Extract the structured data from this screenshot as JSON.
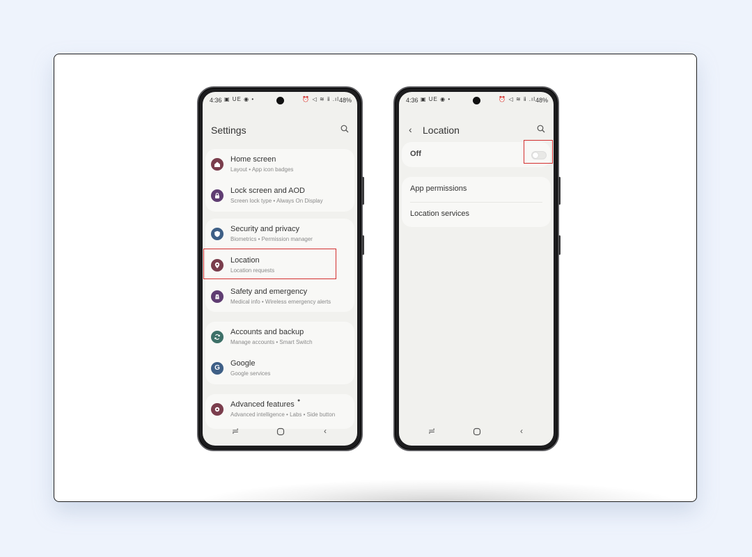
{
  "status_bar": {
    "time": "4:36",
    "left_icons": "▣ UE ◉ •",
    "right_icons": "⏰ ◁ ≋ ⅱ .ıl",
    "battery": "48%"
  },
  "left_phone": {
    "title": "Settings",
    "items": [
      {
        "label": "Home screen",
        "sub": "Layout • App icon badges",
        "icon": "home-icon",
        "color": "#7a3d4c"
      },
      {
        "label": "Lock screen and AOD",
        "sub": "Screen lock type • Always On Display",
        "icon": "lock-icon",
        "color": "#5f3d72"
      },
      {
        "label": "Security and privacy",
        "sub": "Biometrics • Permission manager",
        "icon": "shield-icon",
        "color": "#3e5f86"
      },
      {
        "label": "Location",
        "sub": "Location requests",
        "icon": "location-pin-icon",
        "color": "#7a3d4c"
      },
      {
        "label": "Safety and emergency",
        "sub": "Medical info • Wireless emergency alerts",
        "icon": "emergency-icon",
        "color": "#5f3d72"
      },
      {
        "label": "Accounts and backup",
        "sub": "Manage accounts • Smart Switch",
        "icon": "sync-icon",
        "color": "#3d7068"
      },
      {
        "label": "Google",
        "sub": "Google services",
        "icon": "google-icon",
        "color": "#3e5f86"
      },
      {
        "label": "Advanced features",
        "sub": "Advanced intelligence • Labs • Side button",
        "icon": "gear-star-icon",
        "color": "#7a3d4c"
      }
    ]
  },
  "right_phone": {
    "title": "Location",
    "toggle_label": "Off",
    "toggle_state": "off",
    "items": [
      {
        "label": "App permissions"
      },
      {
        "label": "Location services"
      }
    ]
  },
  "highlight_color": "#d32f2f"
}
